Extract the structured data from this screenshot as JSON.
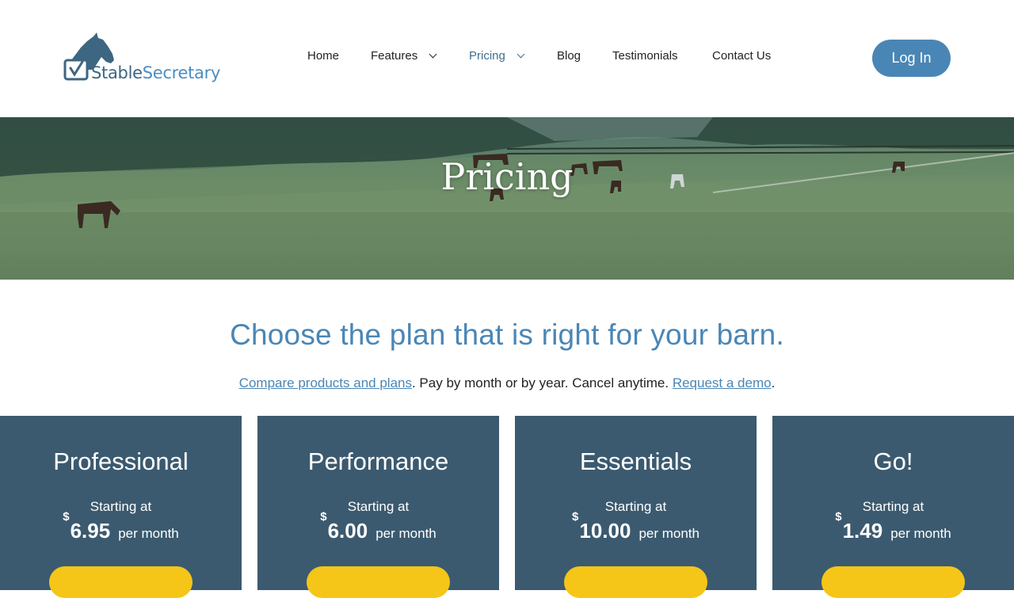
{
  "logo": {
    "part1": "Stable",
    "part2": "Secretary"
  },
  "nav": {
    "items": [
      {
        "label": "Home"
      },
      {
        "label": "Features"
      },
      {
        "label": "Pricing"
      },
      {
        "label": "Blog"
      },
      {
        "label": "Testimonials"
      },
      {
        "label": "Contact Us"
      }
    ],
    "login_label": "Log In"
  },
  "hero": {
    "title": "Pricing"
  },
  "intro": {
    "headline": "Choose the plan that is right for your barn.",
    "compare_link": "Compare products and plans",
    "middle_text": ". Pay by month or by year. Cancel anytime. ",
    "demo_link": "Request a demo",
    "end_text": "."
  },
  "plans": [
    {
      "name": "Professional",
      "starting": "Starting at",
      "currency": "$",
      "price": "6.95",
      "period": "per month"
    },
    {
      "name": "Performance",
      "starting": "Starting at",
      "currency": "$",
      "price": "6.00",
      "period": "per month"
    },
    {
      "name": "Essentials",
      "starting": "Starting at",
      "currency": "$",
      "price": "10.00",
      "period": "per month"
    },
    {
      "name": "Go!",
      "starting": "Starting at",
      "currency": "$",
      "price": "1.49",
      "period": "per month"
    }
  ],
  "colors": {
    "accent": "#4a86b5",
    "card_bg": "#3b5a6f",
    "button_yellow": "#f5c518"
  }
}
